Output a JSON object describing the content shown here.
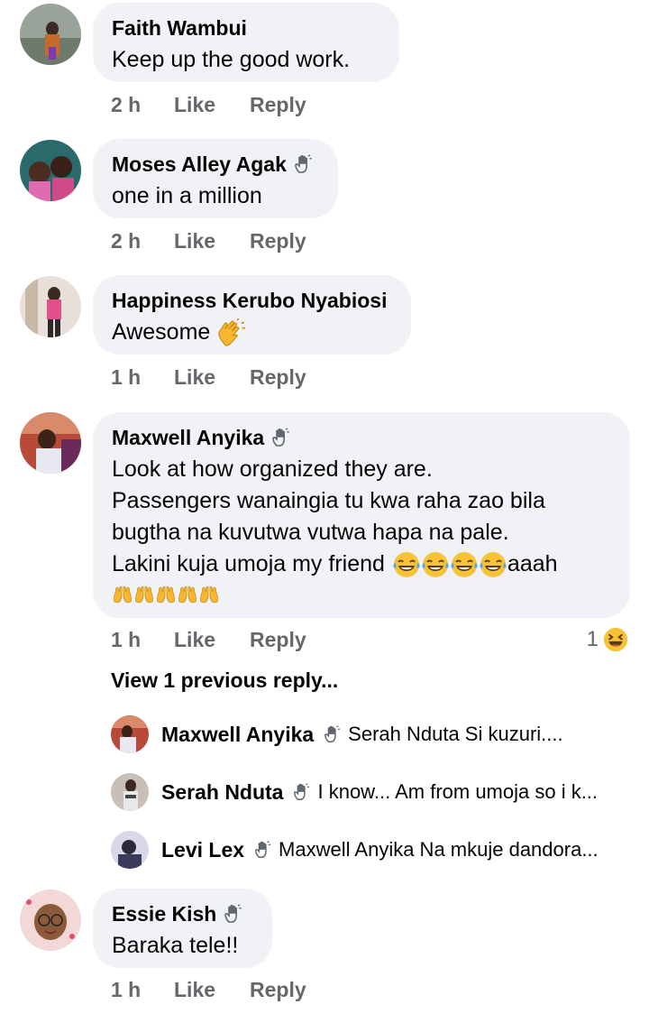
{
  "comments": [
    {
      "name": "Faith Wambui",
      "text": "Keep up the good work.",
      "time": "2 h",
      "like": "Like",
      "reply": "Reply"
    },
    {
      "name": "Moses Alley Agak",
      "text": "one in a million",
      "time": "2 h",
      "like": "Like",
      "reply": "Reply"
    },
    {
      "name": "Happiness Kerubo Nyabiosi",
      "text": "Awesome",
      "time": "1 h",
      "like": "Like",
      "reply": "Reply"
    },
    {
      "name": "Maxwell Anyika",
      "lines": [
        "Look at how organized they are.",
        "Passengers wanaingia tu kwa raha zao bila",
        "bugtha na kuvutwa vutwa hapa na pale.",
        "Lakini kuja umoja my friend"
      ],
      "suffix": "aaah",
      "time": "1 h",
      "like": "Like",
      "reply": "Reply",
      "reaction_count": "1"
    },
    {
      "name": "Essie Kish",
      "text": "Baraka tele!!",
      "time": "1 h",
      "like": "Like",
      "reply": "Reply"
    }
  ],
  "view_previous": "View 1 previous reply...",
  "replies": [
    {
      "name": "Maxwell Anyika",
      "text": "Serah Nduta Si kuzuri...."
    },
    {
      "name": "Serah Nduta",
      "text": "I know... Am from umoja so i k..."
    },
    {
      "name": "Levi Lex",
      "text": "Maxwell Anyika Na mkuje dandora..."
    }
  ],
  "icons": {
    "badge": "fan-badge-icon",
    "clap": "clapping-hands-emoji",
    "laugh": "tears-of-joy-emoji",
    "haha": "laughing-reaction-icon",
    "raised": "raised-hands-emoji"
  }
}
